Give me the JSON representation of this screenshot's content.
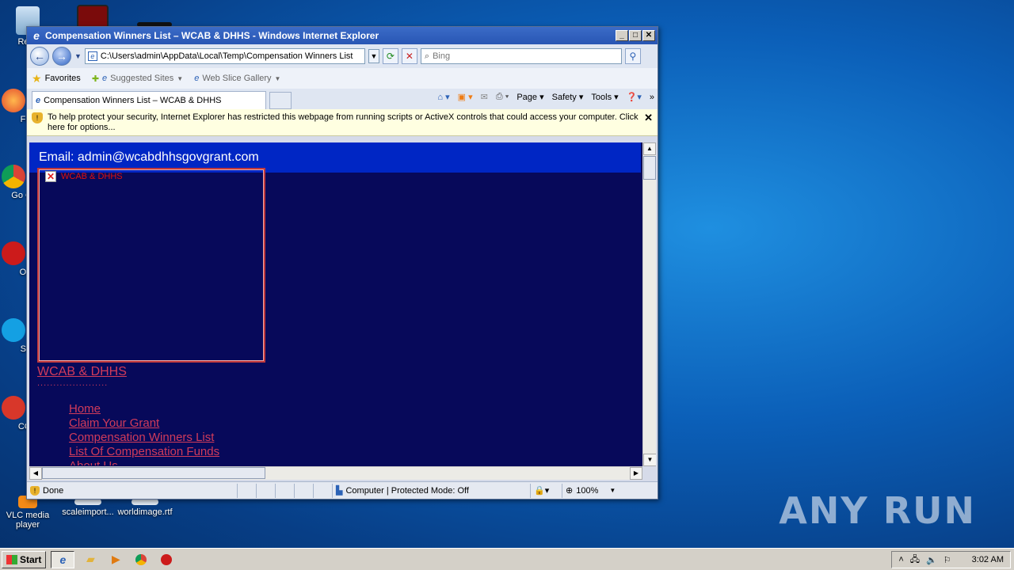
{
  "desktop": {
    "icons": [
      {
        "label": "Recy",
        "name": "recycle-bin"
      },
      {
        "label": "Fir",
        "name": "firefox"
      },
      {
        "label": "Go Chr",
        "name": "chrome"
      },
      {
        "label": "Op",
        "name": "opera"
      },
      {
        "label": "Sk",
        "name": "skype"
      },
      {
        "label": "CCl",
        "name": "ccleaner"
      },
      {
        "label": "VLC media player",
        "name": "vlc"
      },
      {
        "label": "scaleimport...",
        "name": "scaleimport"
      },
      {
        "label": "worldimage.rtf",
        "name": "worldimage"
      }
    ],
    "watermark": "ANY RUN"
  },
  "window": {
    "title": "Compensation Winners List – WCAB & DHHS - Windows Internet Explorer",
    "controls": [
      "_",
      "□",
      "✕"
    ]
  },
  "addressbar": {
    "url": "C:\\Users\\admin\\AppData\\Local\\Temp\\Compensation Winners List",
    "search_placeholder": "Bing"
  },
  "favorites": {
    "label": "Favorites",
    "items": [
      "Suggested Sites",
      "Web Slice Gallery"
    ]
  },
  "tab": {
    "label": "Compensation Winners List – WCAB & DHHS"
  },
  "commandbar": [
    "Page",
    "Safety",
    "Tools"
  ],
  "infobar": {
    "message": "To help protect your security, Internet Explorer has restricted this webpage from running scripts or ActiveX controls that could access your computer. Click here for options..."
  },
  "page": {
    "email_banner": "Email: admin@wcabdhhsgovgrant.com",
    "broken_image_alt": "WCAB & DHHS",
    "site_link": "WCAB & DHHS",
    "dots": "......................",
    "menu": [
      "Home",
      "Claim Your Grant",
      "Compensation Winners List",
      "List Of Compensation Funds",
      "About Us"
    ]
  },
  "status": {
    "left": "Done",
    "zone": "Computer | Protected Mode: Off",
    "zoom": "100%"
  },
  "taskbar": {
    "start_label": "Start",
    "clock": "3:02 AM"
  },
  "colors": {
    "page_bg": "#07095a",
    "banner": "#0026c4",
    "link": "#d13b5a"
  }
}
